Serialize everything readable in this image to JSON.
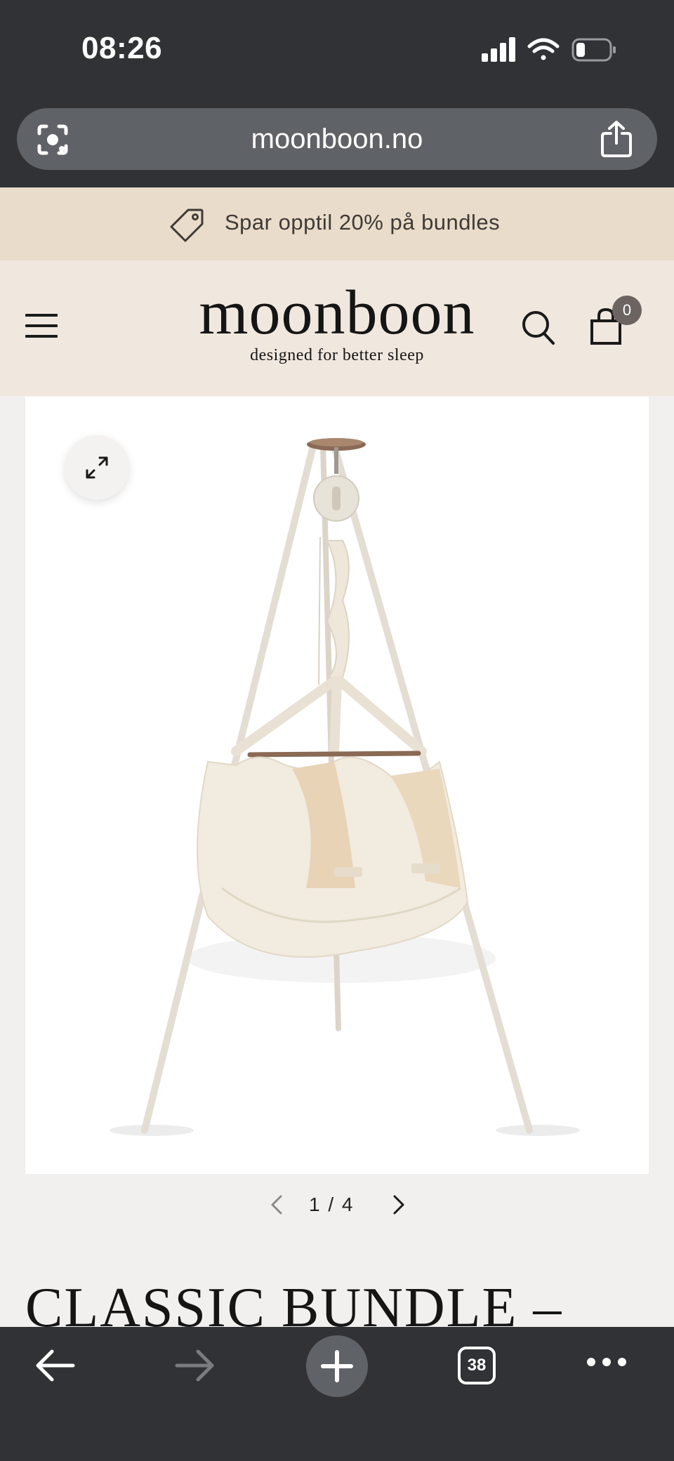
{
  "status_bar": {
    "time": "08:26"
  },
  "browser": {
    "url": "moonboon.no",
    "icons": {
      "lens": "google-lens-icon",
      "share": "share-icon",
      "back": "back-arrow-icon",
      "forward": "forward-arrow-icon",
      "new_tab": "plus-icon",
      "menu": "more-dots-icon"
    },
    "tab_count": "38"
  },
  "promo": {
    "text": "Spar opptil 20% på bundles",
    "icon": "price-tag-icon"
  },
  "header": {
    "logo": "moonboon",
    "tagline": "designed for better sleep",
    "cart_count": "0",
    "icons": {
      "menu": "hamburger-icon",
      "search": "search-icon",
      "cart": "shopping-bag-icon"
    }
  },
  "gallery": {
    "current": "1",
    "separator": "/",
    "total": "4",
    "expand_icon": "expand-icon"
  },
  "product": {
    "title": "CLASSIC BUNDLE –"
  },
  "colors": {
    "chrome": "#303236",
    "url_bar": "#5f6266",
    "promo_bg": "#e9dcca",
    "header_bg": "#f0e7de",
    "page_bg": "#f1f0ef",
    "badge": "#6b6460"
  }
}
